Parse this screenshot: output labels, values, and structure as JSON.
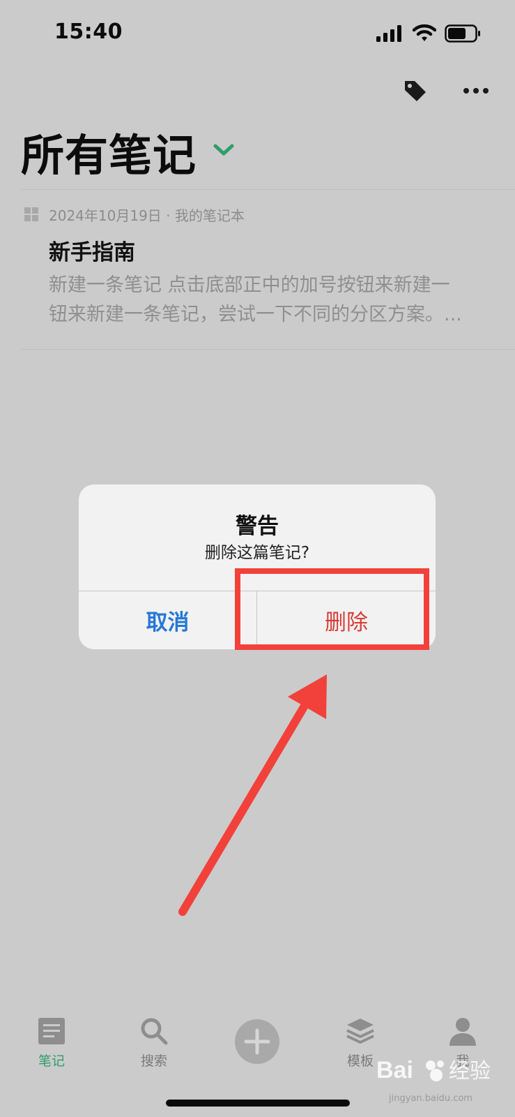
{
  "status_bar": {
    "time": "15:40"
  },
  "header": {
    "title": "所有笔记"
  },
  "note": {
    "meta": "2024年10月19日 · 我的笔记本",
    "title": "新手指南",
    "snippet_lines": [
      "新建一条笔记 点击底部正中的加号按钮来新建一",
      "钮来新建一条笔记，尝试一下不同的分区方案。..."
    ]
  },
  "dialog": {
    "title": "警告",
    "message": "删除这篇笔记?",
    "cancel_label": "取消",
    "delete_label": "删除"
  },
  "tab_bar": {
    "items": [
      {
        "label": "笔记",
        "icon": "notes-icon",
        "active": true
      },
      {
        "label": "搜索",
        "icon": "search-icon",
        "active": false
      },
      {
        "label": "",
        "icon": "plus-icon",
        "active": false
      },
      {
        "label": "模板",
        "icon": "layers-icon",
        "active": false
      },
      {
        "label": "我",
        "icon": "person-icon",
        "active": false
      }
    ]
  },
  "watermark": {
    "brand": "Bai度经验",
    "url": "jingyan.baidu.com"
  },
  "colors": {
    "background": "#cbcbcb",
    "accent_green": "#2f9e6a",
    "cancel_blue": "#2578d6",
    "delete_red": "#d63d36",
    "annotation_red": "#f2413a"
  }
}
